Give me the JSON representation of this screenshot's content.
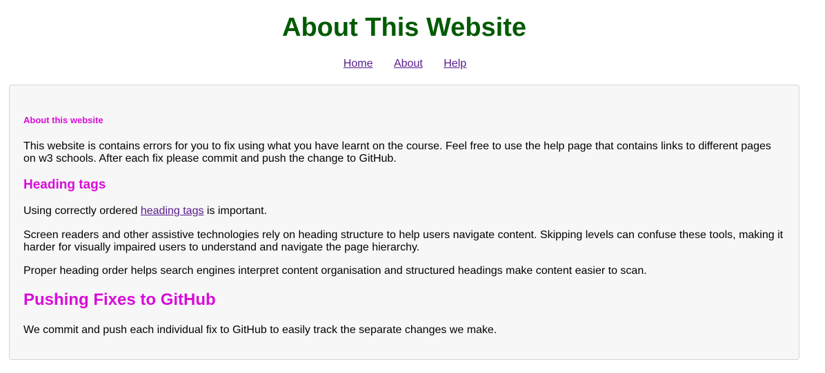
{
  "colors": {
    "title": "#005a00",
    "heading": "#d90cd9",
    "link": "#551a8b",
    "card_bg": "#f7f7f7",
    "card_border": "#d6d6d6"
  },
  "header": {
    "title": "About This Website"
  },
  "nav": {
    "items": [
      {
        "label": "Home"
      },
      {
        "label": "About"
      },
      {
        "label": "Help"
      }
    ]
  },
  "content": {
    "section_heading": "About this website",
    "intro": "This website is contains errors for you to fix using what you have learnt on the course. Feel free to use the help page that contains links to different pages on w3 schools. After each fix please commit and push the change to GitHub.",
    "heading_tags": {
      "title": "Heading tags",
      "p1_before": "Using correctly ordered ",
      "p1_link": "heading tags",
      "p1_after": " is important.",
      "p2": "Screen readers and other assistive technologies rely on heading structure to help users navigate content. Skipping levels can confuse these tools, making it harder for visually impaired users to understand and navigate the page hierarchy.",
      "p3": "Proper heading order helps search engines interpret content organisation and structured headings make content easier to scan."
    },
    "github": {
      "title": "Pushing Fixes to GitHub",
      "p": "We commit and push each individual fix to GitHub to easily track the separate changes we make."
    }
  }
}
